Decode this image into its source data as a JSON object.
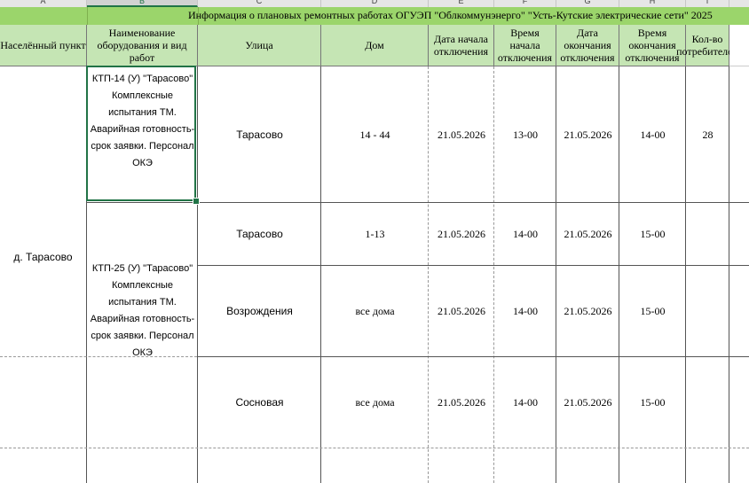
{
  "columns": [
    "A",
    "B",
    "C",
    "D",
    "E",
    "F",
    "G",
    "H",
    "I"
  ],
  "selected_column": "B",
  "title": "Информация о плановых ремонтных работах ОГУЭП \"Облкоммунэнерго\" \"Усть-Кутские электрические сети\" 2025",
  "headers": {
    "settlement": "Населённый пункт",
    "equipment": "Наименование оборудования и вид работ",
    "street": "Улица",
    "house": "Дом",
    "start_date": "Дата начала отключения",
    "start_time": "Время начала отключения",
    "end_date": "Дата окончания отключения",
    "end_time": "Время окончания отключения",
    "consumers": "Кол-во потребителей"
  },
  "settlement": "д. Тарасово",
  "equipment_1": "КТП-14 (У) \"Тарасово\" Комплексные испытания ТМ. Аварийная готовность-срок заявки. Персонал ОКЭ",
  "equipment_2": "КТП-25 (У) \"Тарасово\" Комплексные испытания ТМ. Аварийная готовность-срок заявки. Персонал ОКЭ",
  "rows": [
    {
      "street": "Тарасово",
      "house": "14 - 44",
      "start_date": "21.05.2026",
      "start_time": "13-00",
      "end_date": "21.05.2026",
      "end_time": "14-00",
      "consumers": "28"
    },
    {
      "street": "Тарасово",
      "house": "1-13",
      "start_date": "21.05.2026",
      "start_time": "14-00",
      "end_date": "21.05.2026",
      "end_time": "15-00",
      "consumers": ""
    },
    {
      "street": "Возрождения",
      "house": "все дома",
      "start_date": "21.05.2026",
      "start_time": "14-00",
      "end_date": "21.05.2026",
      "end_time": "15-00",
      "consumers": ""
    },
    {
      "street": "Сосновая",
      "house": "все дома",
      "start_date": "21.05.2026",
      "start_time": "14-00",
      "end_date": "21.05.2026",
      "end_time": "15-00",
      "consumers": ""
    }
  ],
  "colors": {
    "title_bg": "#9bd56b",
    "header_bg": "#c5e5b4",
    "selection": "#217346"
  }
}
